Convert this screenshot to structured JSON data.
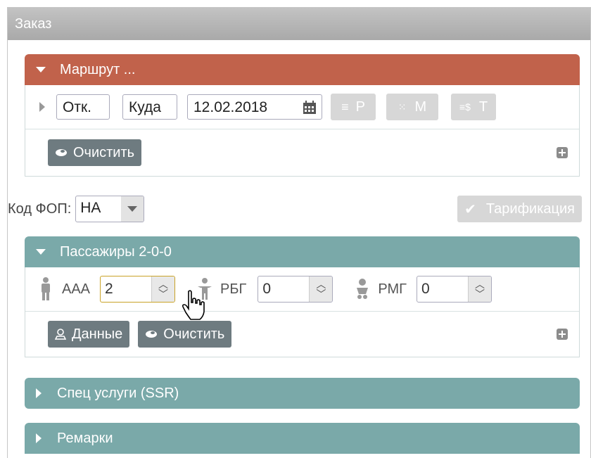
{
  "panel": {
    "title": "Заказ"
  },
  "route": {
    "title": "Маршрут ...",
    "from_value": "Отк.",
    "to_value": "Куда",
    "date_value": "12.02.2018",
    "btn_p": "P",
    "btn_m": "M",
    "btn_t": "T",
    "clear_label": "Очистить"
  },
  "fop": {
    "label": "Код ФОП:",
    "value": "НА",
    "tarif_label": "Тарификация"
  },
  "passengers": {
    "title": "Пассажиры 2-0-0",
    "adult_label": "ААА",
    "adult_value": "2",
    "child_label": "РБГ",
    "child_value": "0",
    "infant_label": "РМГ",
    "infant_value": "0",
    "data_label": "Данные",
    "clear_label": "Очистить"
  },
  "ssr": {
    "title": "Спец услуги (SSR)"
  },
  "remarks": {
    "title": "Ремарки"
  },
  "colors": {
    "route_header": "#c1624b",
    "teal_header": "#7aa9a9",
    "dark_button": "#6e7b80"
  }
}
